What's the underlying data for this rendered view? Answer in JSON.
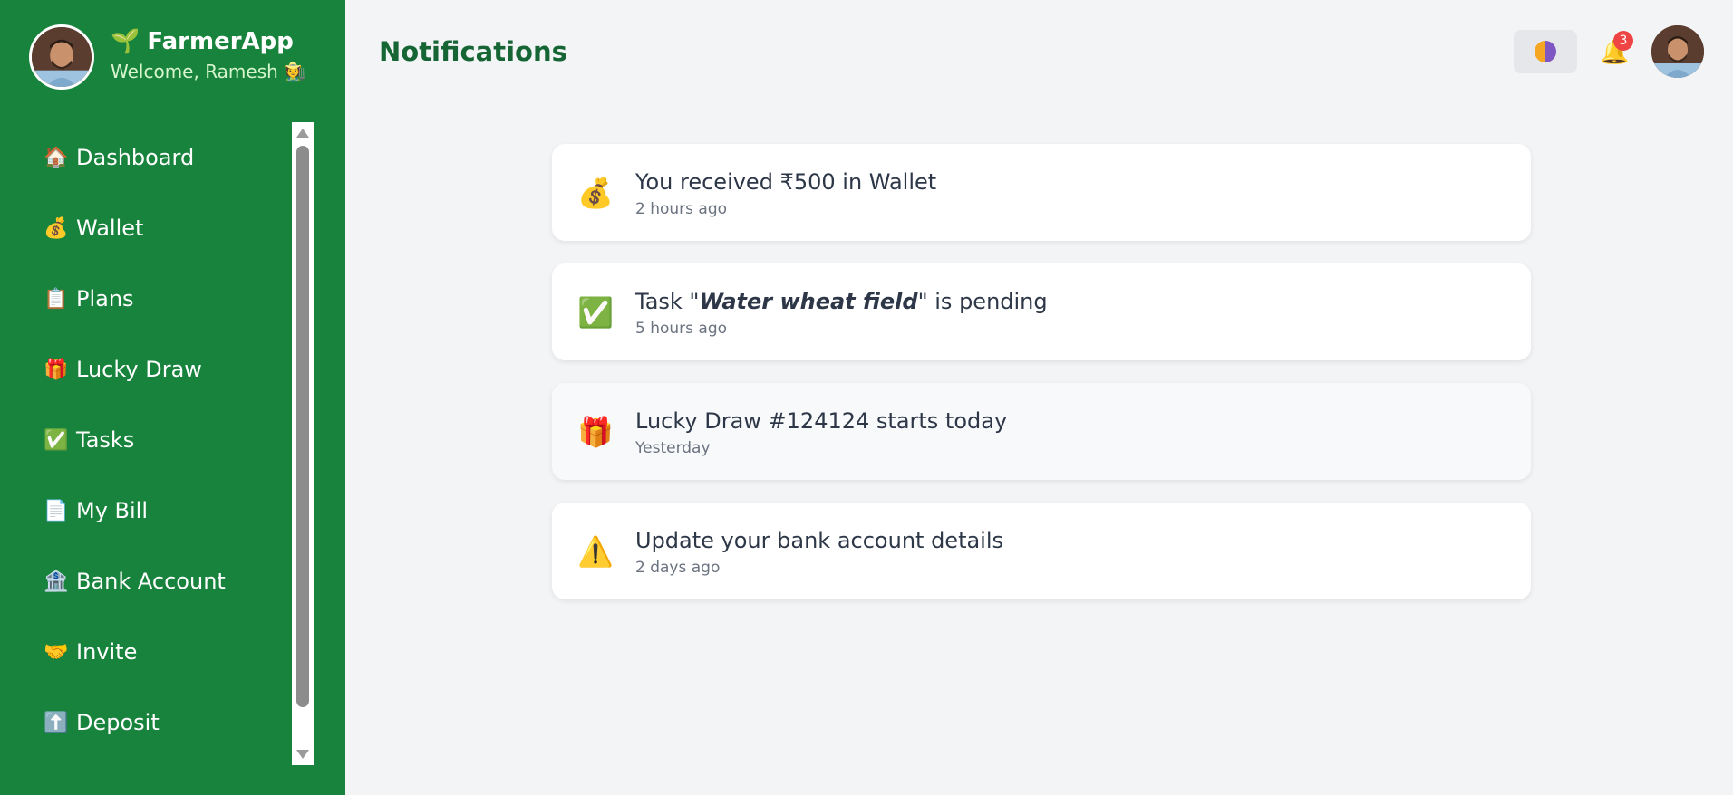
{
  "sidebar": {
    "brand_icon": "🌱",
    "brand_name": "FarmerApp",
    "welcome": "Welcome, Ramesh 🧑‍🌾",
    "items": [
      {
        "icon": "🏠",
        "icon_name": "home-icon",
        "label": "Dashboard"
      },
      {
        "icon": "💰",
        "icon_name": "money-bag-icon",
        "label": "Wallet"
      },
      {
        "icon": "📋",
        "icon_name": "clipboard-icon",
        "label": "Plans"
      },
      {
        "icon": "🎁",
        "icon_name": "gift-icon",
        "label": "Lucky Draw"
      },
      {
        "icon": "✅",
        "icon_name": "check-icon",
        "label": "Tasks"
      },
      {
        "icon": "📄",
        "icon_name": "bill-icon",
        "label": "My Bill"
      },
      {
        "icon": "🏦",
        "icon_name": "bank-icon",
        "label": "Bank Account"
      },
      {
        "icon": "🤝",
        "icon_name": "handshake-icon",
        "label": "Invite"
      },
      {
        "icon": "⬆️",
        "icon_name": "deposit-arrow-icon",
        "label": "Deposit"
      }
    ]
  },
  "header": {
    "title": "Notifications",
    "notification_count": "3",
    "bell_icon": "🔔"
  },
  "notifications": [
    {
      "icon": "💰",
      "icon_name": "money-bag-icon",
      "title_pre": "You received ₹500 in Wallet",
      "title_em": "",
      "title_post": "",
      "time": "2 hours ago",
      "highlight": false
    },
    {
      "icon": "✅",
      "icon_name": "check-icon",
      "title_pre": "Task \"",
      "title_em": "Water wheat field",
      "title_post": "\" is pending",
      "time": "5 hours ago",
      "highlight": false
    },
    {
      "icon": "🎁",
      "icon_name": "gift-icon",
      "title_pre": "Lucky Draw #124124 starts today",
      "title_em": "",
      "title_post": "",
      "time": "Yesterday",
      "highlight": true
    },
    {
      "icon": "⚠️",
      "icon_name": "warning-icon",
      "title_pre": "Update your bank account details",
      "title_em": "",
      "title_post": "",
      "time": "2 days ago",
      "highlight": false
    }
  ],
  "colors": {
    "sidebar_bg": "#18833c",
    "title": "#166534",
    "badge": "#ef4444",
    "page_bg": "#f3f4f6"
  }
}
